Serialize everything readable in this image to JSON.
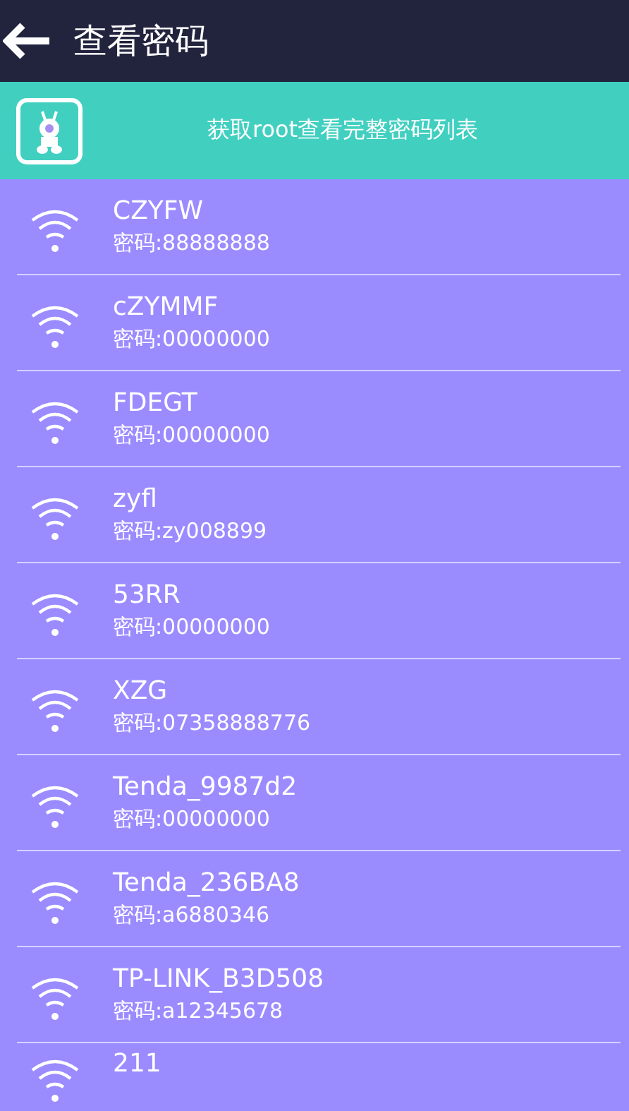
{
  "app_bar": {
    "title": "查看密码"
  },
  "banner": {
    "text": "获取root查看完整密码列表"
  },
  "networks": [
    {
      "name": "CZYFW",
      "password": "密码:88888888"
    },
    {
      "name": "cZYMMF",
      "password": "密码:00000000"
    },
    {
      "name": "FDEGT",
      "password": "密码:00000000"
    },
    {
      "name": "zyfl",
      "password": "密码:zy008899"
    },
    {
      "name": "53RR",
      "password": "密码:00000000"
    },
    {
      "name": "XZG",
      "password": "密码:07358888776"
    },
    {
      "name": "Tenda_9987d2",
      "password": "密码:00000000"
    },
    {
      "name": "Tenda_236BA8",
      "password": "密码:a6880346"
    },
    {
      "name": "TP-LINK_B3D508",
      "password": "密码:a12345678"
    },
    {
      "name": "211"
    }
  ]
}
